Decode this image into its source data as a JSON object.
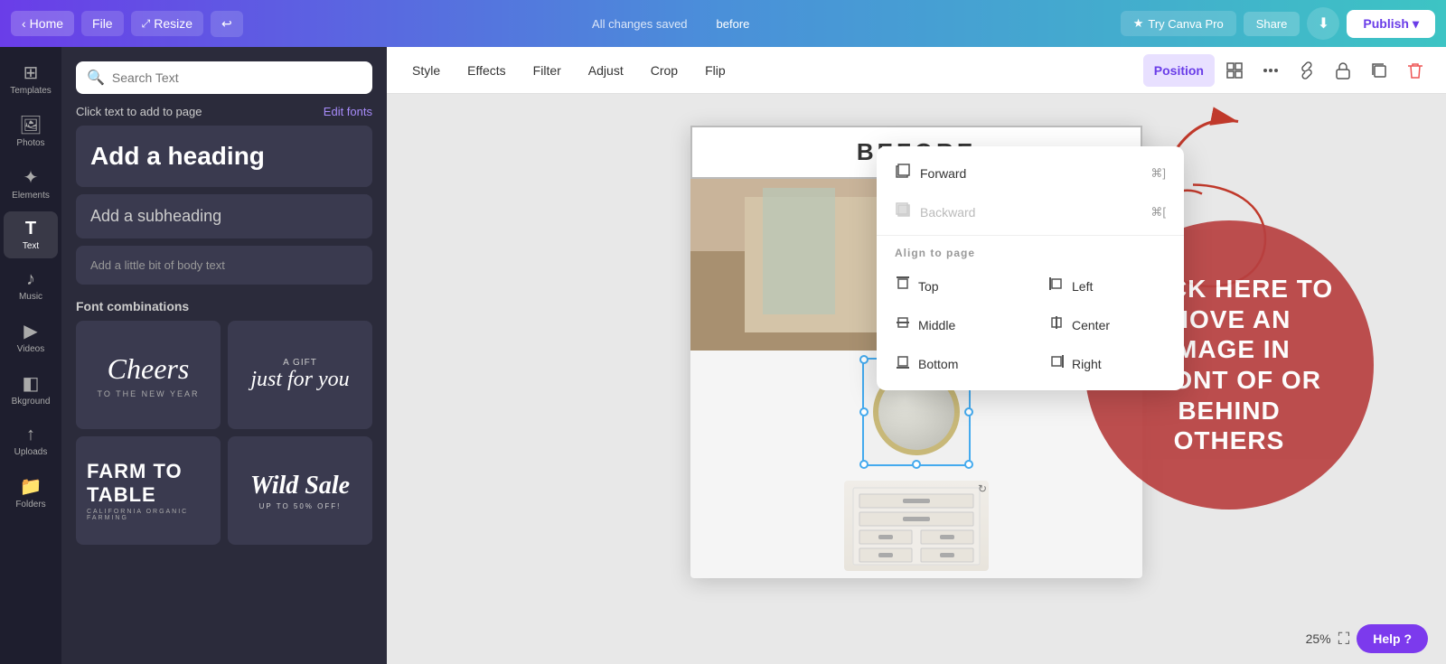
{
  "topbar": {
    "home_label": "Home",
    "file_label": "File",
    "resize_label": "Resize",
    "undo_label": "↩",
    "status_label": "All changes saved",
    "before_label": "before",
    "canvapro_label": "Try Canva Pro",
    "share_label": "Share",
    "publish_label": "Publish"
  },
  "sidebar": {
    "items": [
      {
        "id": "templates",
        "label": "Templates",
        "icon": "⊞"
      },
      {
        "id": "photos",
        "label": "Photos",
        "icon": "🖼"
      },
      {
        "id": "elements",
        "label": "Elements",
        "icon": "✦"
      },
      {
        "id": "text",
        "label": "Text",
        "icon": "T"
      },
      {
        "id": "music",
        "label": "Music",
        "icon": "♪"
      },
      {
        "id": "videos",
        "label": "Videos",
        "icon": "▶"
      },
      {
        "id": "background",
        "label": "Bkground",
        "icon": "◧"
      },
      {
        "id": "uploads",
        "label": "Uploads",
        "icon": "↑"
      },
      {
        "id": "folders",
        "label": "Folders",
        "icon": "📁"
      }
    ]
  },
  "panel": {
    "search_placeholder": "Search Text",
    "click_text_label": "Click text to add to page",
    "edit_fonts_label": "Edit fonts",
    "heading_label": "Add a heading",
    "subheading_label": "Add a subheading",
    "body_label": "Add a little bit of body text",
    "font_combos_label": "Font combinations",
    "font_combos": [
      {
        "id": "cheers",
        "title": "Cheers",
        "subtitle": "TO THE NEW YEAR"
      },
      {
        "id": "gift",
        "title": "just for you",
        "subtitle": "A GIFT"
      },
      {
        "id": "farm",
        "title": "FARM TO TABLE",
        "subtitle": "CALIFORNIA ORGANIC FARMING"
      },
      {
        "id": "sale",
        "title": "Wild Sale",
        "subtitle": "UP TO 50% OFF!"
      }
    ]
  },
  "toolbar": {
    "style_label": "Style",
    "effects_label": "Effects",
    "filter_label": "Filter",
    "adjust_label": "Adjust",
    "crop_label": "Crop",
    "flip_label": "Flip",
    "position_label": "Position"
  },
  "position_menu": {
    "forward_label": "Forward",
    "forward_shortcut": "⌘]",
    "backward_label": "Backward",
    "backward_shortcut": "⌘[",
    "align_label": "Align to page",
    "top_label": "Top",
    "middle_label": "Middle",
    "bottom_label": "Bottom",
    "left_label": "Left",
    "center_label": "Center",
    "right_label": "Right"
  },
  "canvas": {
    "before_label": "BEFORE",
    "zoom_value": "25%"
  },
  "annotation": {
    "circle_text": "CLICK HERE TO MOVE AN IMAGE IN FRONT OF OR BEHIND OTHERS"
  },
  "zoom_bar": {
    "zoom_value": "25%",
    "expand_icon": "⛶",
    "help_label": "Help ?"
  }
}
